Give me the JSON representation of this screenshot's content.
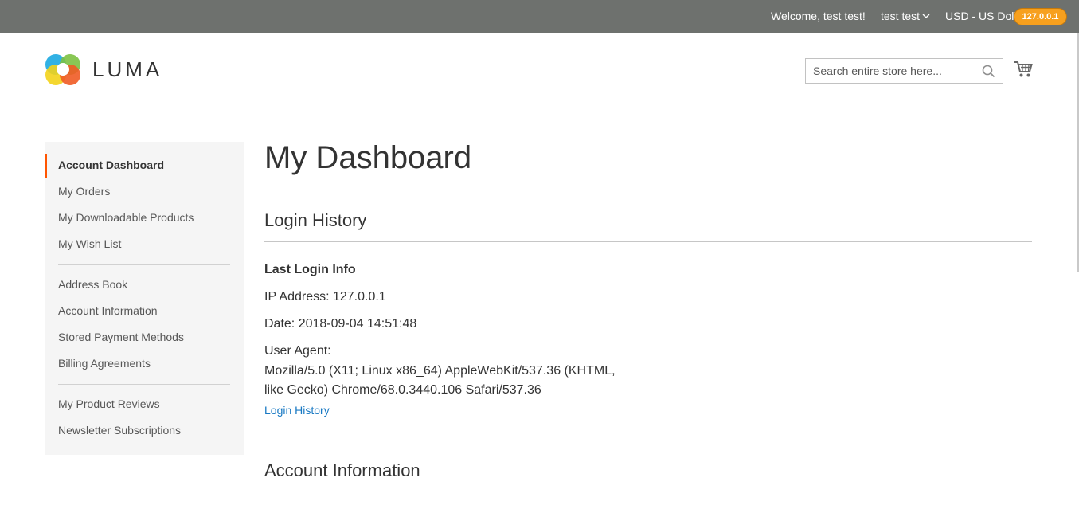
{
  "header": {
    "welcome": "Welcome, test test!",
    "user_menu": "test test",
    "currency": "USD - US Dollar",
    "ip_badge": "127.0.0.1"
  },
  "logo": {
    "text": "LUMA"
  },
  "search": {
    "placeholder": "Search entire store here..."
  },
  "icons": {
    "search": "search-icon",
    "cart": "cart-icon",
    "user_menu_arrow": "chevron-down-icon"
  },
  "sidebar": {
    "items": [
      {
        "label": "Account Dashboard",
        "active": true
      },
      {
        "label": "My Orders"
      },
      {
        "label": "My Downloadable Products"
      },
      {
        "label": "My Wish List"
      },
      {
        "label": "Address Book"
      },
      {
        "label": "Account Information"
      },
      {
        "label": "Stored Payment Methods"
      },
      {
        "label": "Billing Agreements"
      },
      {
        "label": "My Product Reviews"
      },
      {
        "label": "Newsletter Subscriptions"
      }
    ]
  },
  "main": {
    "title": "My Dashboard",
    "login_history": {
      "title": "Login History",
      "subtitle": "Last Login Info",
      "ip": "IP Address: 127.0.0.1",
      "date": "Date: 2018-09-04 14:51:48",
      "user_agent_label": "User Agent:",
      "user_agent_value": "Mozilla/5.0 (X11; Linux x86_64) AppleWebKit/537.36 (KHTML, like Gecko) Chrome/68.0.3440.106 Safari/537.36",
      "link": "Login History"
    },
    "account_information": {
      "title": "Account Information"
    }
  },
  "colors": {
    "topbar": "#6e716e",
    "accent": "#ff5501",
    "link": "#1979c3",
    "badge": "#f7a01e"
  }
}
